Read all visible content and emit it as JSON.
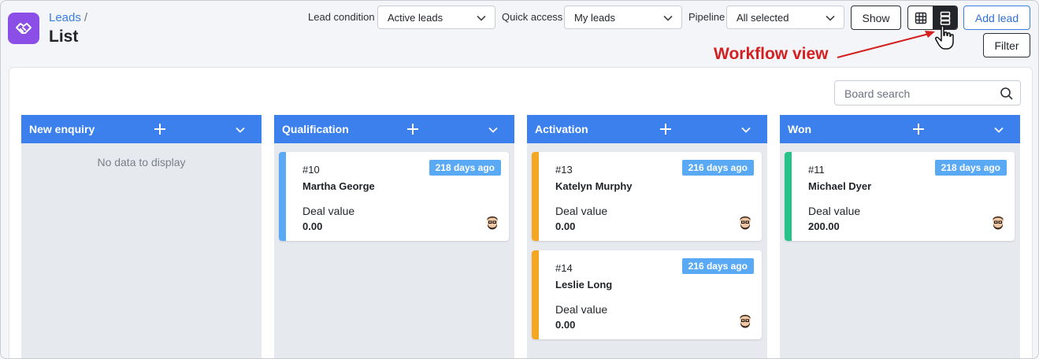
{
  "header": {
    "breadcrumb": "Leads",
    "breadcrumb_sep": "/",
    "title": "List"
  },
  "filters": {
    "lead_condition": {
      "label": "Lead condition",
      "value": "Active leads"
    },
    "quick_access": {
      "label": "Quick access",
      "value": "My leads"
    },
    "pipeline": {
      "label": "Pipeline",
      "value": "All selected"
    }
  },
  "toolbar": {
    "show_label": "Show",
    "add_lead_label": "Add lead",
    "filter_label": "Filter"
  },
  "annotation": {
    "text": "Workflow view",
    "color": "#d42020"
  },
  "board": {
    "search_placeholder": "Board search",
    "empty_message": "No data to display",
    "columns": [
      {
        "title": "New enquiry",
        "cards": []
      },
      {
        "title": "Qualification",
        "cards": [
          {
            "id": "#10",
            "name": "Martha George",
            "age": "218 days ago",
            "deal_label": "Deal value",
            "deal_value": "0.00",
            "stripe": "#5aa9f5"
          }
        ]
      },
      {
        "title": "Activation",
        "cards": [
          {
            "id": "#13",
            "name": "Katelyn Murphy",
            "age": "216 days ago",
            "deal_label": "Deal value",
            "deal_value": "0.00",
            "stripe": "#f5a623"
          },
          {
            "id": "#14",
            "name": "Leslie Long",
            "age": "216 days ago",
            "deal_label": "Deal value",
            "deal_value": "0.00",
            "stripe": "#f5a623"
          }
        ]
      },
      {
        "title": "Won",
        "cards": [
          {
            "id": "#11",
            "name": "Michael Dyer",
            "age": "218 days ago",
            "deal_label": "Deal value",
            "deal_value": "200.00",
            "stripe": "#27c28a"
          }
        ]
      }
    ]
  },
  "colors": {
    "accent": "#3b80ec",
    "logo": "#8b4ee6",
    "badge": "#5aa9f5"
  }
}
